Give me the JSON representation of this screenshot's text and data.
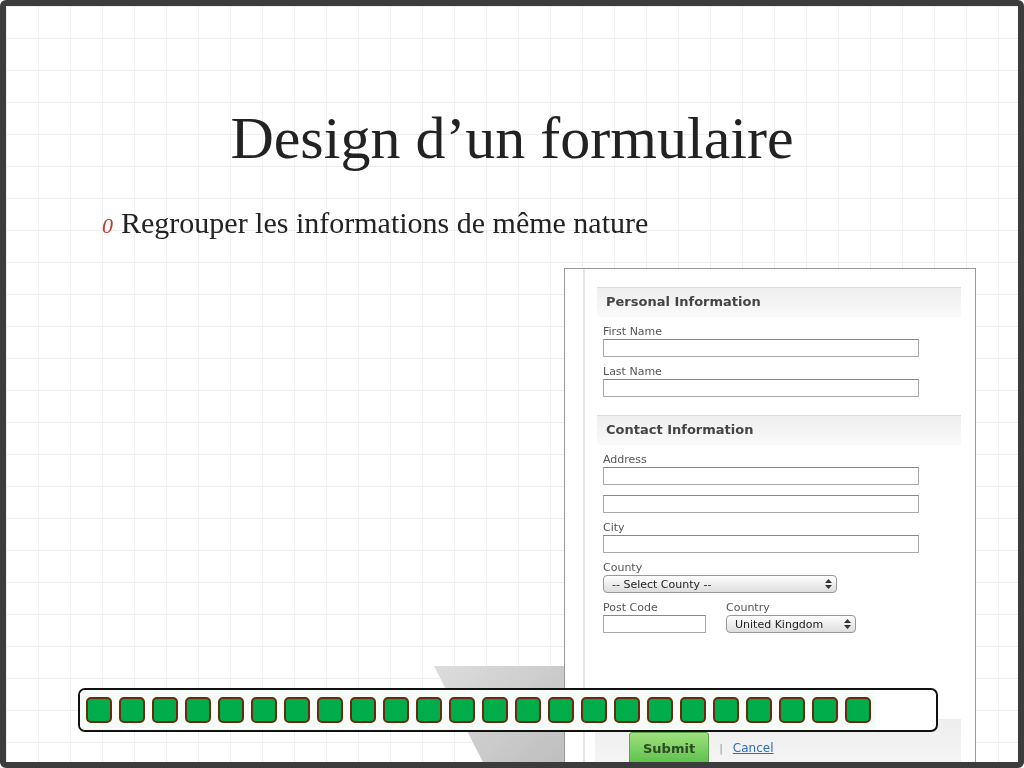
{
  "slide": {
    "title": "Design d’un formulaire",
    "bullets": [
      {
        "marker": "0",
        "text": "Regrouper les informations de même nature"
      }
    ]
  },
  "form": {
    "sections": [
      {
        "heading": "Personal Information",
        "fields": [
          {
            "kind": "text",
            "label": "First Name"
          },
          {
            "kind": "text",
            "label": "Last Name"
          }
        ]
      },
      {
        "heading": "Contact Information",
        "fields": [
          {
            "kind": "text",
            "label": "Address"
          },
          {
            "kind": "text"
          },
          {
            "kind": "text",
            "label": "City"
          },
          {
            "kind": "select",
            "label": "County",
            "value": "-- Select County --"
          },
          {
            "kind": "pair",
            "items": [
              {
                "kind": "text",
                "label": "Post Code"
              },
              {
                "kind": "select",
                "label": "Country",
                "value": "United Kingdom"
              }
            ]
          }
        ]
      }
    ],
    "submit": "Submit",
    "separator": "|",
    "cancel": "Cancel"
  },
  "progress": {
    "level": 0.93
  }
}
